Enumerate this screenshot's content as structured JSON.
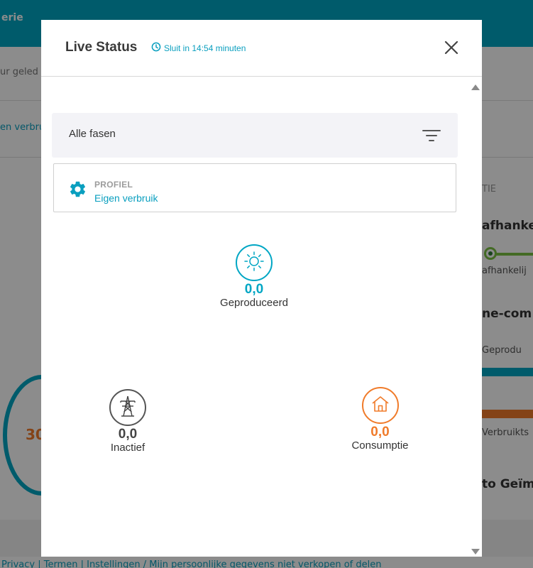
{
  "background": {
    "topbar_text": "erie",
    "row1_text": "ur geled",
    "row2_text": "en verbrui",
    "right_card": {
      "section": "TIE",
      "heading1": "afhanke",
      "small1": "afhankelij",
      "heading2": "ne-com",
      "small2": "Geprodu",
      "small3": "Verbruikts",
      "heading3": "to Geïm"
    },
    "ring_number": "30",
    "footer_text": "Privacy  |  Termen  |  Instellingen / Mijn persoonlijke gegevens niet verkopen of delen"
  },
  "modal": {
    "title": "Live Status",
    "timer_text": "Sluit in 14:54 minuten",
    "phase_select": {
      "label": "Alle fasen"
    },
    "profile": {
      "caption": "PROFIEL",
      "value": "Eigen verbruik"
    },
    "nodes": {
      "produced": {
        "value": "0,0",
        "label": "Geproduceerd"
      },
      "grid": {
        "value": "0,0",
        "label": "Inactief"
      },
      "consumption": {
        "value": "0,0",
        "label": "Consumptie"
      }
    }
  },
  "colors": {
    "accent": "#00a6c4",
    "link": "#0a9fbf",
    "consumption": "#f07b2a",
    "grid": "#555555"
  },
  "icons": [
    "clock-icon",
    "close-icon",
    "filter-icon",
    "gear-icon",
    "sun-icon",
    "power-tower-icon",
    "house-icon",
    "scroll-up-icon",
    "scroll-down-icon"
  ]
}
